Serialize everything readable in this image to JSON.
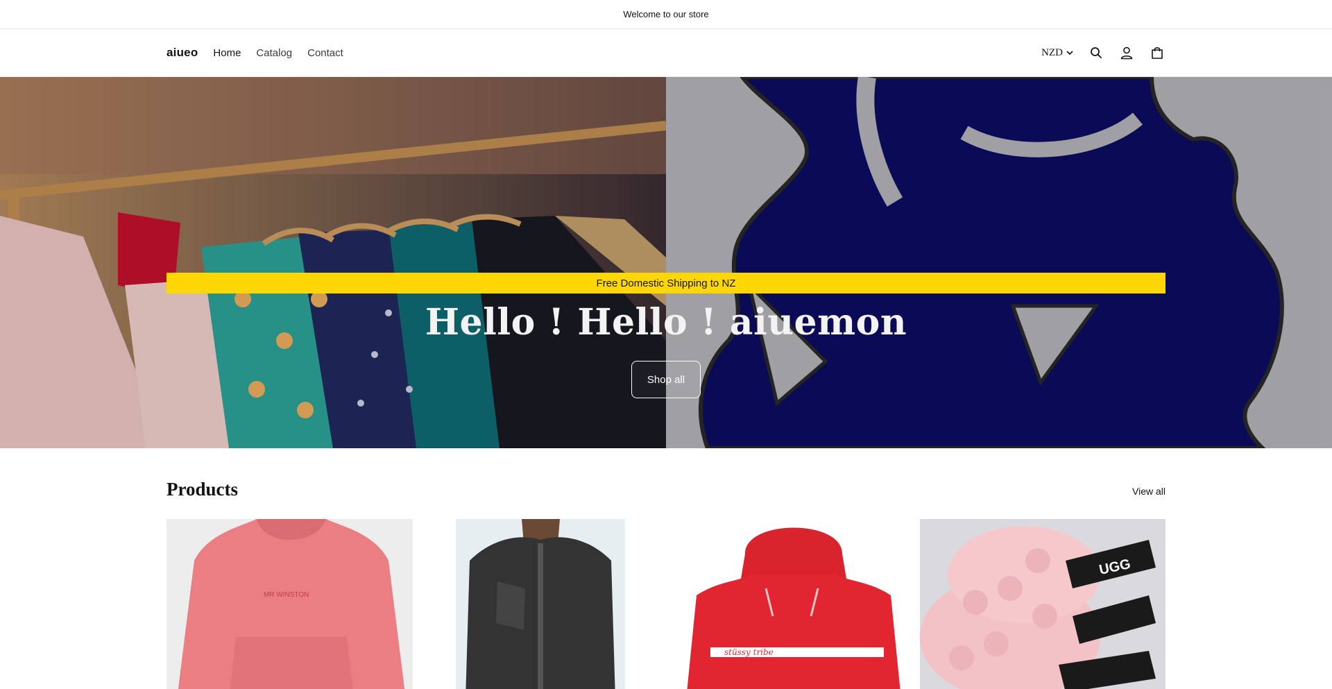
{
  "announcement": {
    "text": "Welcome to our store"
  },
  "header": {
    "logo": "aiueo",
    "nav": [
      {
        "label": "Home"
      },
      {
        "label": "Catalog"
      },
      {
        "label": "Contact"
      }
    ],
    "currency": "NZD",
    "icons": [
      "search-icon",
      "account-icon",
      "cart-icon"
    ]
  },
  "hero": {
    "banner_text": "Free Domestic Shipping to NZ",
    "title": "Hello ! Hello ! aiuemon",
    "button_label": "Shop all",
    "banner_color": "#ffd803",
    "right_image_accent": "#0c0c63"
  },
  "products": {
    "title": "Products",
    "view_all": "View all",
    "items": [
      {
        "image": "pink-hoodie",
        "print": "MR WINSTON"
      },
      {
        "image": "black-leather-jacket"
      },
      {
        "image": "red-hoodie",
        "print": "stüssy tribe"
      },
      {
        "image": "pink-ugg-slippers",
        "print": "UGG"
      }
    ]
  }
}
